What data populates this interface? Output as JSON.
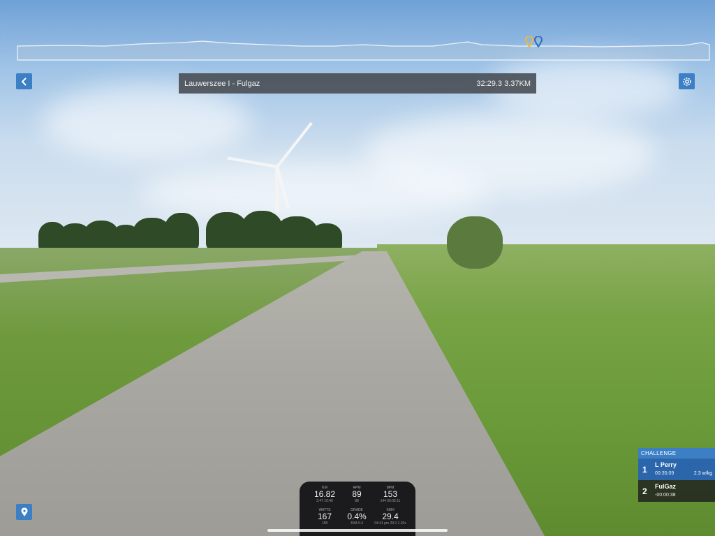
{
  "route": {
    "title": "Lauwerszee I - Fulgaz",
    "time_distance": "32:29.3 3.37KM"
  },
  "icons": {
    "back": "chevron-left-icon",
    "settings": "gear-icon",
    "map": "map-pin-icon",
    "profile_markers": [
      "rider-pin-yellow-icon",
      "rider-pin-blue-icon"
    ]
  },
  "challenge": {
    "header": "CHALLENGE",
    "entries": [
      {
        "position": "1",
        "name": "L Perry",
        "time": "00:35:09",
        "wkg": "2.3 w/kg"
      },
      {
        "position": "2",
        "name": "FulGaz",
        "time": "-00:00:38",
        "wkg": ""
      }
    ]
  },
  "bike_computer": {
    "cells": [
      {
        "label": "KM",
        "value": "16.82",
        "sub": "3:47 10:40"
      },
      {
        "label": "RPM",
        "value": "89",
        "sub": "88"
      },
      {
        "label": "BPM",
        "value": "153",
        "sub": "144 00:05:11"
      },
      {
        "label": "WATTS",
        "value": "167",
        "sub": "158"
      },
      {
        "label": "GRADE",
        "value": "0.4%",
        "sub": "40M 0.3"
      },
      {
        "label": "KMH",
        "value": "29.4",
        "sub": "04:41 pm 29.0 1.02x"
      }
    ]
  },
  "colors": {
    "accent_blue": "#3c7fc4",
    "title_bar_bg": "#464a50",
    "challenge_row1": "#2b66aa"
  }
}
